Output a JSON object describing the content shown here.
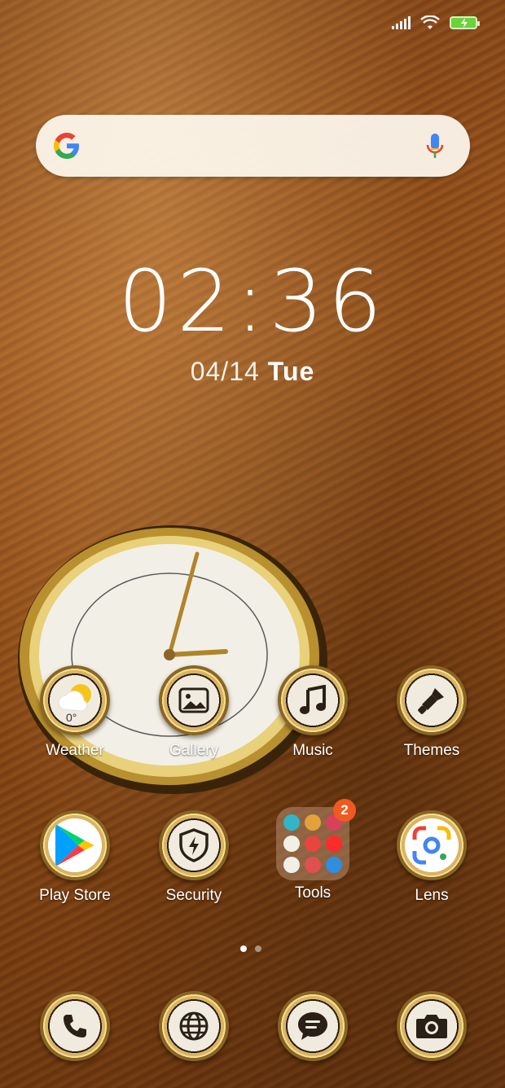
{
  "status_bar": {
    "signal_icon": "signal-icon",
    "wifi_icon": "wifi-icon",
    "battery_icon": "battery-charging-icon"
  },
  "search_bar": {
    "logo": "google-logo-icon",
    "voice_icon": "mic-icon"
  },
  "clock": {
    "time": "02:36",
    "date": "04/14",
    "weekday": "Tue"
  },
  "home_icons": [
    {
      "label": "Weather",
      "icon": "weather-icon",
      "temperature": "0°"
    },
    {
      "label": "Gallery",
      "icon": "gallery-icon"
    },
    {
      "label": "Music",
      "icon": "music-icon"
    },
    {
      "label": "Themes",
      "icon": "themes-brush-icon"
    },
    {
      "label": "Play Store",
      "icon": "play-store-icon"
    },
    {
      "label": "Security",
      "icon": "security-shield-icon"
    },
    {
      "label": "Tools",
      "icon": "folder-icon",
      "badge": "2"
    },
    {
      "label": "Lens",
      "icon": "lens-icon"
    }
  ],
  "dock": [
    {
      "icon": "phone-icon"
    },
    {
      "icon": "browser-globe-icon"
    },
    {
      "icon": "messages-icon"
    },
    {
      "icon": "camera-icon"
    }
  ],
  "page_indicator": {
    "pages": 2,
    "active": 1
  },
  "colors": {
    "accent_gold": "#d8b462",
    "badge": "#f05a22",
    "battery": "#6bd33a"
  }
}
